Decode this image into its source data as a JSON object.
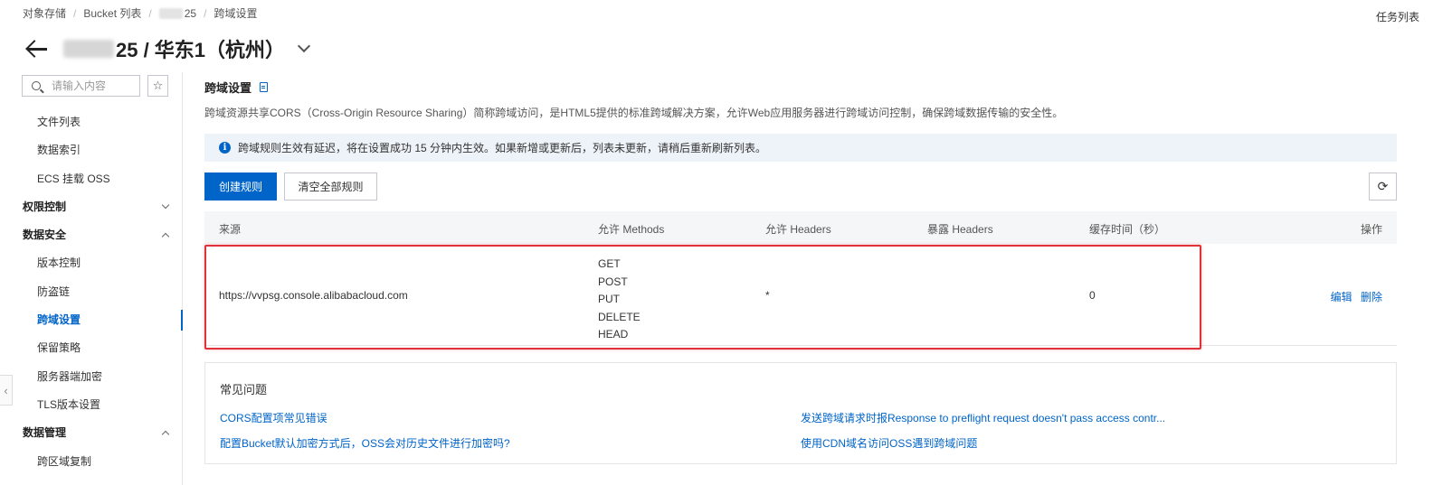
{
  "breadcrumb": {
    "items": [
      "对象存储",
      "Bucket 列表",
      "25",
      "跨域设置"
    ]
  },
  "header": {
    "title_suffix": "25 / 华东1（杭州）",
    "task_list": "任务列表"
  },
  "sidebar": {
    "search_placeholder": "请输入内容",
    "items": [
      {
        "label": "文件列表",
        "type": "sub"
      },
      {
        "label": "数据索引",
        "type": "sub"
      },
      {
        "label": "ECS 挂载 OSS",
        "type": "sub"
      },
      {
        "label": "权限控制",
        "type": "group",
        "expanded": false
      },
      {
        "label": "数据安全",
        "type": "group",
        "expanded": true
      },
      {
        "label": "版本控制",
        "type": "sub"
      },
      {
        "label": "防盗链",
        "type": "sub"
      },
      {
        "label": "跨域设置",
        "type": "sub",
        "active": true
      },
      {
        "label": "保留策略",
        "type": "sub"
      },
      {
        "label": "服务器端加密",
        "type": "sub"
      },
      {
        "label": "TLS版本设置",
        "type": "sub"
      },
      {
        "label": "数据管理",
        "type": "group",
        "expanded": true
      },
      {
        "label": "跨区域复制",
        "type": "sub"
      }
    ]
  },
  "main": {
    "title": "跨域设置",
    "description": "跨域资源共享CORS（Cross-Origin Resource Sharing）简称跨域访问，是HTML5提供的标准跨域解决方案，允许Web应用服务器进行跨域访问控制，确保跨域数据传输的安全性。",
    "notice": "跨域规则生效有延迟，将在设置成功 15 分钟内生效。如果新增或更新后，列表未更新，请稍后重新刷新列表。",
    "create_button": "创建规则",
    "clear_button": "清空全部规则",
    "table": {
      "headers": {
        "origin": "来源",
        "methods": "允许 Methods",
        "allow_headers": "允许 Headers",
        "expose_headers": "暴露 Headers",
        "cache_time": "缓存时间（秒）",
        "actions": "操作"
      },
      "rows": [
        {
          "origin": "https://vvpsg.console.alibabacloud.com",
          "methods": [
            "GET",
            "POST",
            "PUT",
            "DELETE",
            "HEAD"
          ],
          "allow_headers": "*",
          "expose_headers": "",
          "cache_time": "0",
          "edit": "编辑",
          "delete": "删除"
        }
      ]
    },
    "faq": {
      "title": "常见问题",
      "links": [
        "CORS配置项常见错误",
        "发送跨域请求时报Response to preflight request doesn't pass access contr...",
        "配置Bucket默认加密方式后，OSS会对历史文件进行加密吗?",
        "使用CDN域名访问OSS遇到跨域问题"
      ]
    }
  },
  "colors": {
    "accent": "#0064c8",
    "highlight": "#e0323a"
  }
}
